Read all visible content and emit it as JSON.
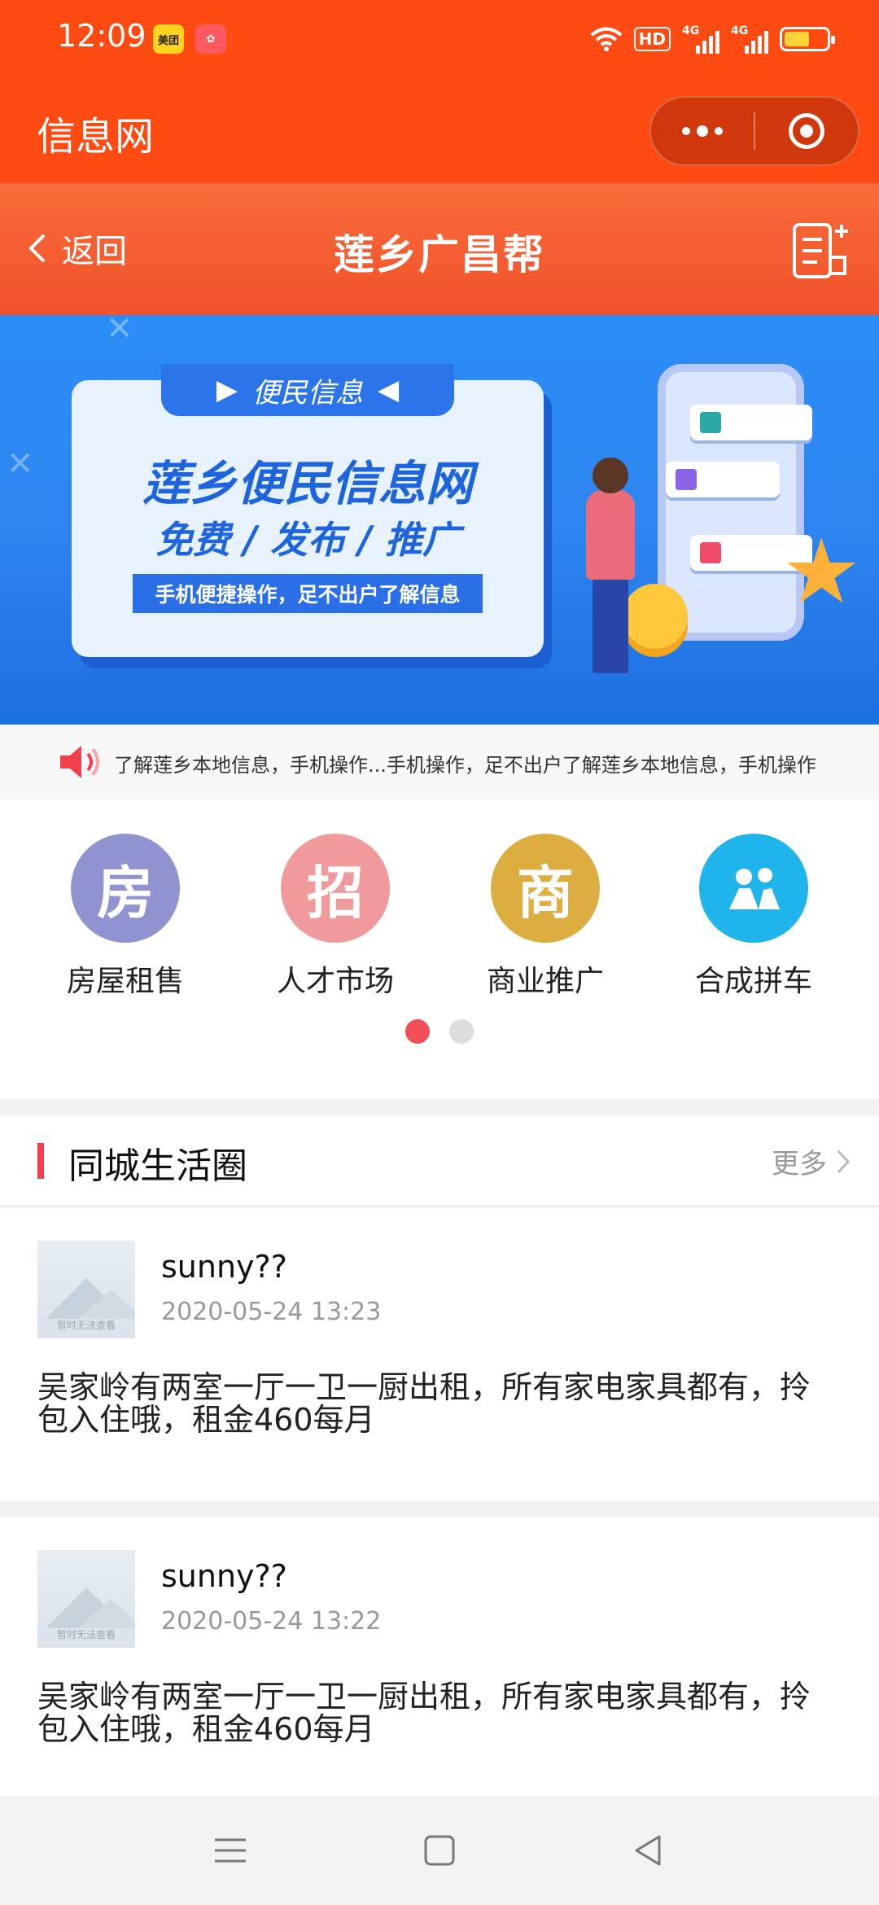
{
  "status_bar": {
    "time": "12:09",
    "app_badges": [
      "美团",
      ""
    ],
    "hd": "HD",
    "signal_1": "4G",
    "signal_2": "4G",
    "battery_level": 0.6
  },
  "mini_program": {
    "title": "信息网"
  },
  "nav": {
    "back_label": "返回",
    "title": "莲乡广昌帮"
  },
  "banner": {
    "tag": "便民信息",
    "headline": "莲乡便民信息网",
    "subline": "免费 / 发布 / 推广",
    "strip": "手机便捷操作，足不出户了解信息"
  },
  "notice": {
    "text": "了解莲乡本地信息，手机操作...手机操作，足不出户了解莲乡本地信息，手机操作"
  },
  "categories": [
    {
      "icon_char": "房",
      "label": "房屋租售",
      "color": "#8f93cf"
    },
    {
      "icon_char": "招",
      "label": "人才市场",
      "color": "#f09a9c"
    },
    {
      "icon_char": "商",
      "label": "商业推广",
      "color": "#dcae3f"
    },
    {
      "icon_char": "",
      "label": "合成拼车",
      "color": "#1fb4ec"
    }
  ],
  "pager": {
    "active_color": "#f25058",
    "inactive_color": "#dddddd"
  },
  "section": {
    "title": "同城生活圈",
    "more": "更多"
  },
  "posts": [
    {
      "user": "sunny??",
      "time": "2020-05-24 13:23",
      "thumb_caption": "暂时无法查看",
      "content": "吴家岭有两室一厅一卫一厨出租，所有家电家具都有，拎包入住哦，租金460每月"
    },
    {
      "user": "sunny??",
      "time": "2020-05-24 13:22",
      "thumb_caption": "暂时无法查看",
      "content": "吴家岭有两室一厅一卫一厨出租，所有家电家具都有，拎包入住哦，租金460每月"
    }
  ],
  "colors": {
    "brand": "#ff4a12",
    "accent_red": "#f2414d"
  }
}
